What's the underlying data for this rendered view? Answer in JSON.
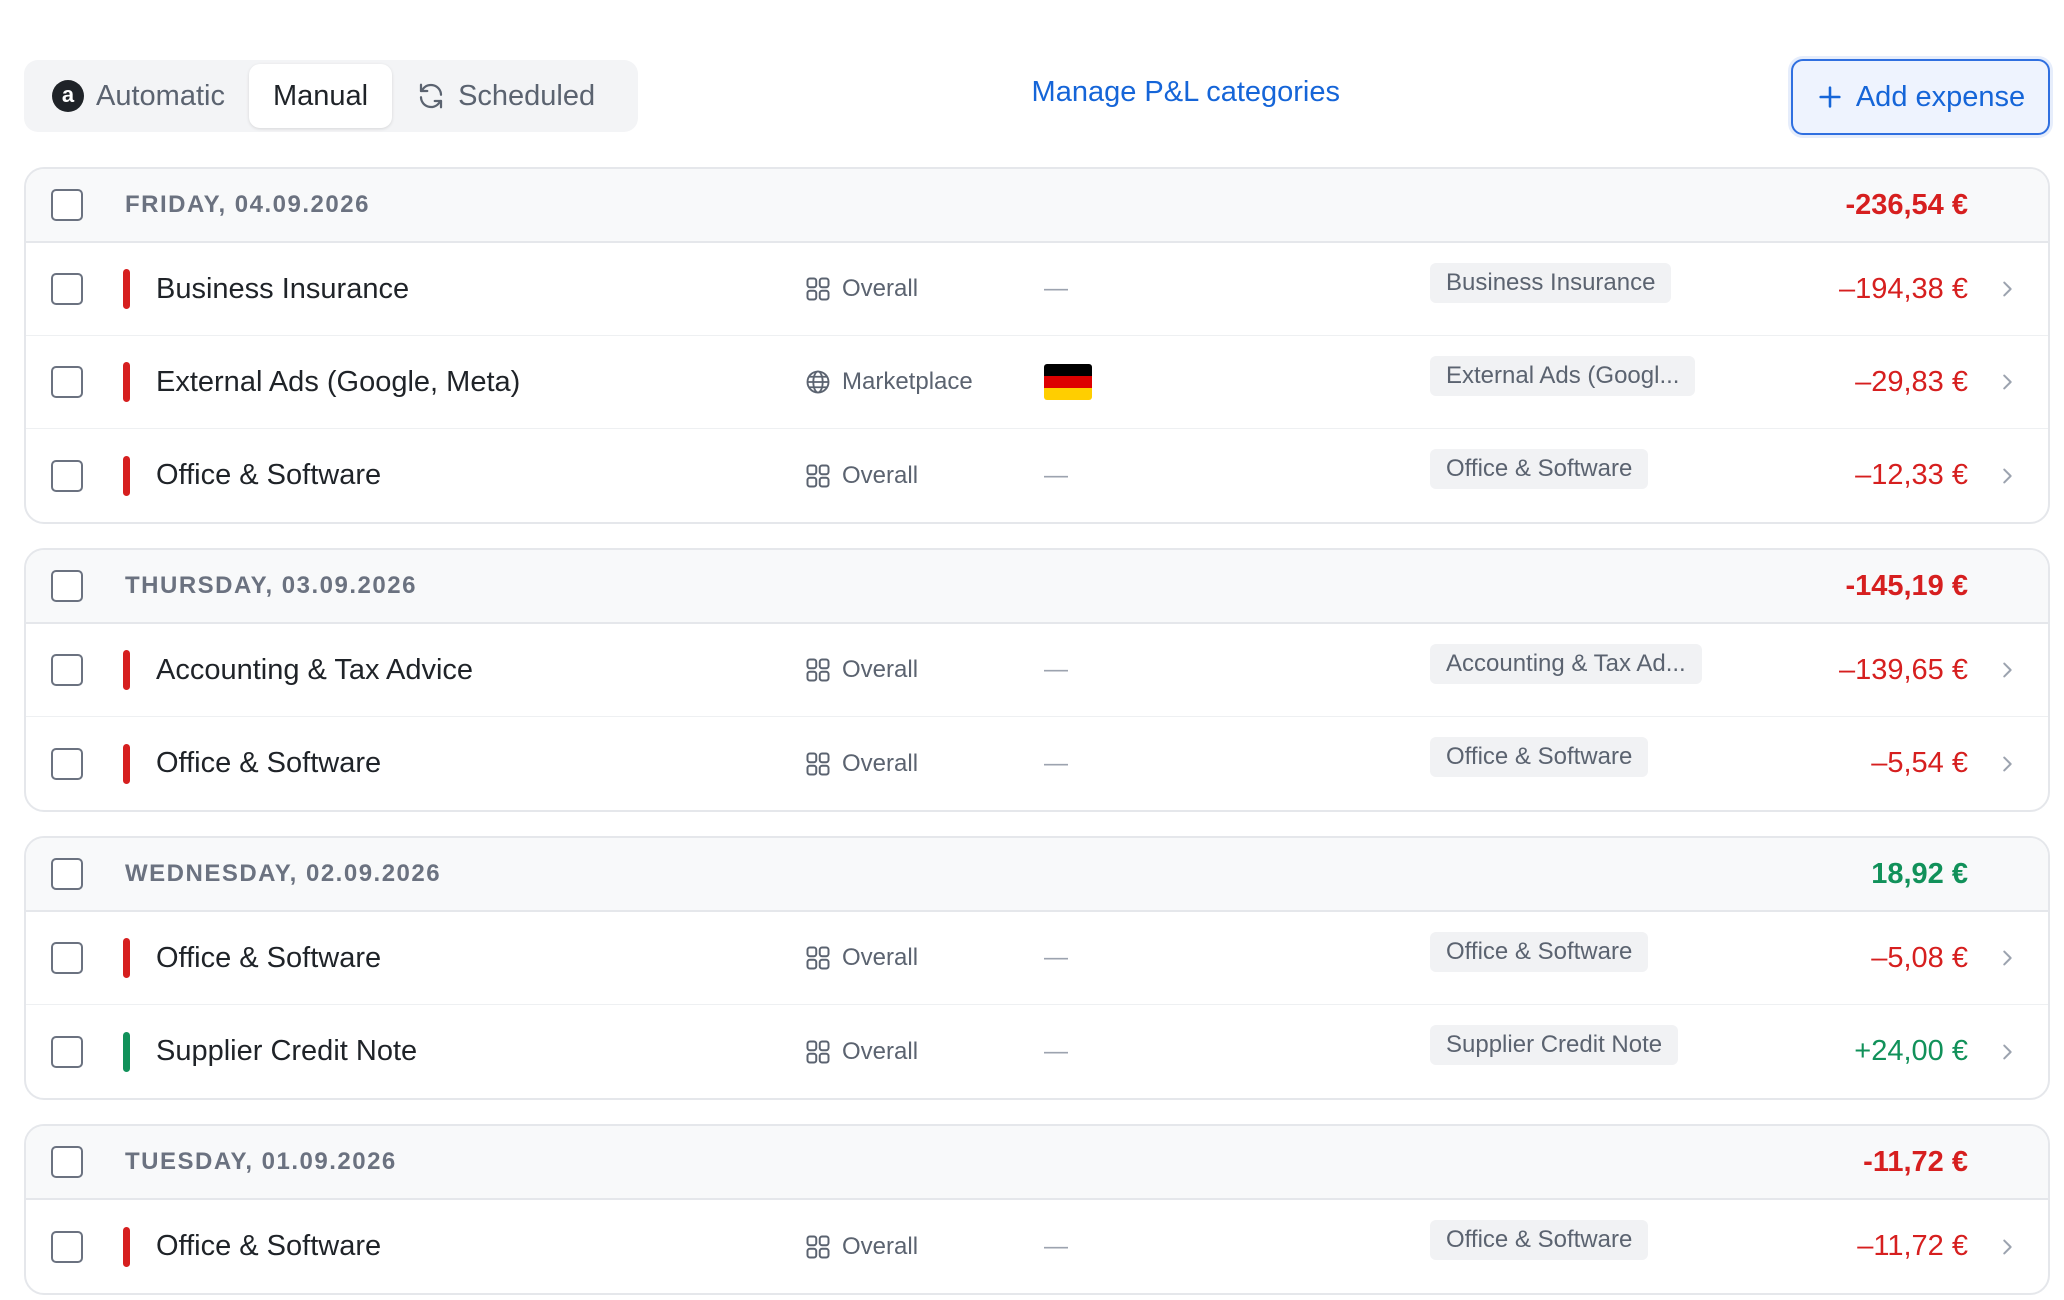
{
  "tabs": [
    {
      "label": "Automatic",
      "icon": "amazon-icon",
      "active": false
    },
    {
      "label": "Manual",
      "icon": "",
      "active": true
    },
    {
      "label": "Scheduled",
      "icon": "refresh-icon",
      "active": false
    }
  ],
  "actions": {
    "manage_link": "Manage P&L categories",
    "add_label": "Add expense"
  },
  "amazon_glyph": "a",
  "colors": {
    "negative": "#d61f1f",
    "positive": "#11915a",
    "accent": "#1565d8"
  },
  "groups": [
    {
      "date": "FRIDAY, 04.09.2026",
      "total": "-236,54 €",
      "total_sign": "neg",
      "rows": [
        {
          "title": "Business Insurance",
          "scope": "Overall",
          "scope_icon": "grid-icon",
          "market": "—",
          "tag": "Business Insurance",
          "amount": "–194,38 €",
          "sign": "neg"
        },
        {
          "title": "External Ads (Google, Meta)",
          "scope": "Marketplace",
          "scope_icon": "globe-icon",
          "market": "flag-de",
          "tag": "External Ads (Googl...",
          "amount": "–29,83 €",
          "sign": "neg"
        },
        {
          "title": "Office & Software",
          "scope": "Overall",
          "scope_icon": "grid-icon",
          "market": "—",
          "tag": "Office & Software",
          "amount": "–12,33 €",
          "sign": "neg"
        }
      ]
    },
    {
      "date": "THURSDAY, 03.09.2026",
      "total": "-145,19 €",
      "total_sign": "neg",
      "rows": [
        {
          "title": "Accounting & Tax Advice",
          "scope": "Overall",
          "scope_icon": "grid-icon",
          "market": "—",
          "tag": "Accounting & Tax Ad...",
          "amount": "–139,65 €",
          "sign": "neg"
        },
        {
          "title": "Office & Software",
          "scope": "Overall",
          "scope_icon": "grid-icon",
          "market": "—",
          "tag": "Office & Software",
          "amount": "–5,54 €",
          "sign": "neg"
        }
      ]
    },
    {
      "date": "WEDNESDAY, 02.09.2026",
      "total": "18,92 €",
      "total_sign": "pos",
      "rows": [
        {
          "title": "Office & Software",
          "scope": "Overall",
          "scope_icon": "grid-icon",
          "market": "—",
          "tag": "Office & Software",
          "amount": "–5,08 €",
          "sign": "neg"
        },
        {
          "title": "Supplier Credit Note",
          "scope": "Overall",
          "scope_icon": "grid-icon",
          "market": "—",
          "tag": "Supplier Credit Note",
          "amount": "+24,00 €",
          "sign": "pos"
        }
      ]
    },
    {
      "date": "TUESDAY, 01.09.2026",
      "total": "-11,72 €",
      "total_sign": "neg",
      "rows": [
        {
          "title": "Office & Software",
          "scope": "Overall",
          "scope_icon": "grid-icon",
          "market": "—",
          "tag": "Office & Software",
          "amount": "–11,72 €",
          "sign": "neg"
        }
      ]
    }
  ]
}
